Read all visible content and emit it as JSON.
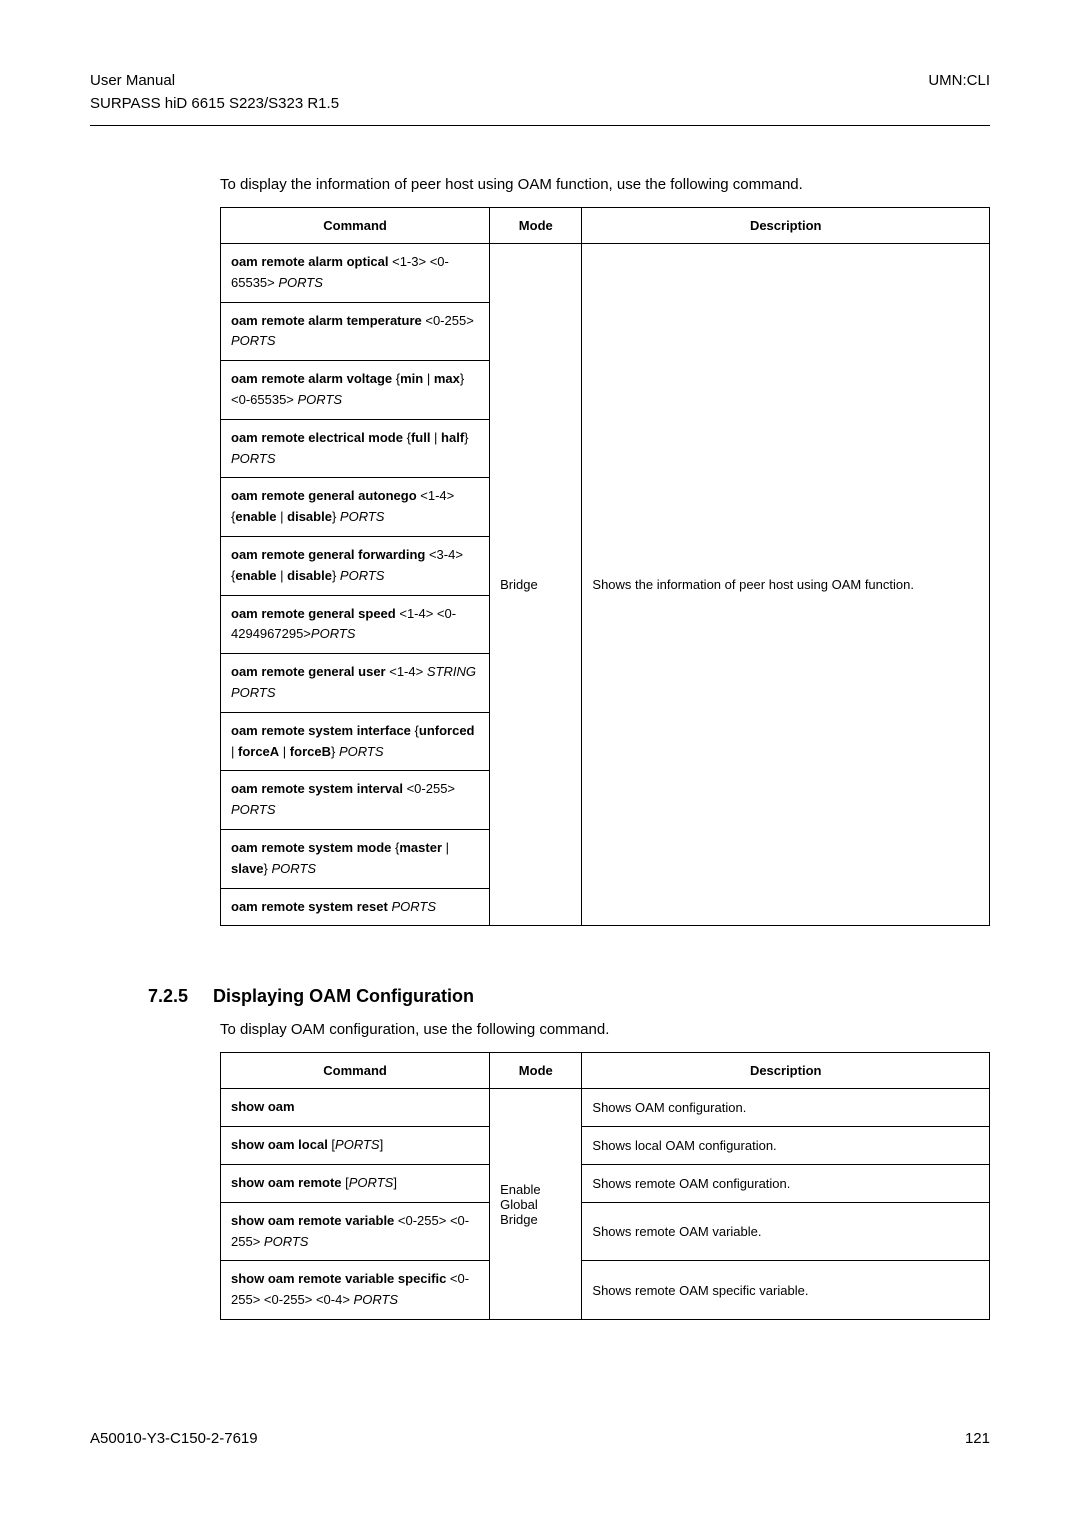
{
  "header": {
    "left_line1": "User Manual",
    "left_line2": "SURPASS hiD 6615 S223/S323 R1.5",
    "right": "UMN:CLI"
  },
  "intro1": "To display the information of peer host using OAM function, use the following command.",
  "table1": {
    "headers": {
      "command": "Command",
      "mode": "Mode",
      "description": "Description"
    },
    "mode": "Bridge",
    "description": "Shows the information of peer host using OAM function.",
    "rows": [
      "<b>oam remote alarm optical</b> &lt;1-3&gt; &lt;0-65535&gt; <i>PORTS</i>",
      "<b>oam remote alarm temperature</b> &lt;0-255&gt; <i>PORTS</i>",
      "<b>oam remote alarm voltage</b> {<b>min</b> | <b>max</b>} &lt;0-65535&gt; <i>PORTS</i>",
      "<b>oam remote electrical mode</b> {<b>full</b> | <b>half</b>} <i>PORTS</i>",
      "<b>oam remote general autonego</b> &lt;1-4&gt; {<b>enable</b> | <b>disable</b>} <i>PORTS</i>",
      "<b>oam remote general forwarding</b> &lt;3-4&gt; {<b>enable</b> | <b>disable</b>} <i>PORTS</i>",
      "<b>oam remote general speed</b> &lt;1-4&gt; &lt;0-4294967295&gt;<i>PORTS</i>",
      "<b>oam remote general user</b> &lt;1-4&gt; <i>STRING PORTS</i>",
      "<b>oam remote system interface</b> {<b>unforced</b> | <b>forceA</b> | <b>forceB</b>} <i>PORTS</i>",
      "<b>oam remote system interval</b> &lt;0-255&gt; <i>PORTS</i>",
      "<b>oam remote system mode</b> {<b>master</b> | <b>slave</b>} <i>PORTS</i>",
      "<b>oam remote system reset</b> <i>PORTS</i>"
    ]
  },
  "section": {
    "number": "7.2.5",
    "title": "Displaying OAM Configuration"
  },
  "intro2": "To display OAM configuration, use the following command.",
  "table2": {
    "headers": {
      "command": "Command",
      "mode": "Mode",
      "description": "Description"
    },
    "mode": "Enable\nGlobal\nBridge",
    "rows": [
      {
        "cmd": "<b>show oam</b>",
        "desc": "Shows OAM configuration."
      },
      {
        "cmd": "<b>show oam local</b> [<i>PORTS</i>]",
        "desc": "Shows local OAM configuration."
      },
      {
        "cmd": "<b>show oam remote</b> [<i>PORTS</i>]",
        "desc": "Shows remote OAM configuration."
      },
      {
        "cmd": "<b>show oam remote variable</b> &lt;0-255&gt; &lt;0-255&gt; <i>PORTS</i>",
        "desc": "Shows remote OAM variable."
      },
      {
        "cmd": "<b>show oam remote variable specific</b> &lt;0-255&gt; &lt;0-255&gt; &lt;0-4&gt; <i>PORTS</i>",
        "desc": "Shows remote OAM specific variable."
      }
    ]
  },
  "footer": {
    "left": "A50010-Y3-C150-2-7619",
    "right": "121"
  }
}
